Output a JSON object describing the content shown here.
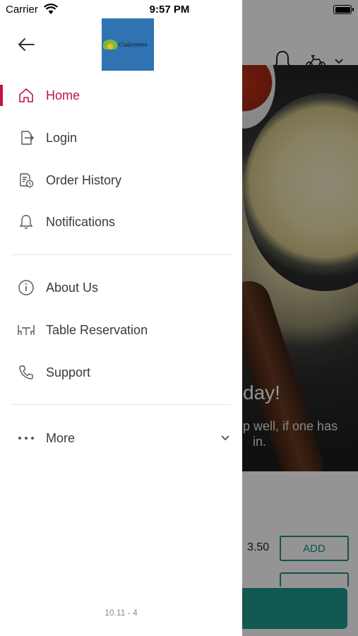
{
  "status_bar": {
    "carrier": "Carrier",
    "time": "9:57 PM"
  },
  "drawer": {
    "menu_primary": [
      {
        "label": "Home",
        "icon": "home-icon",
        "active": true
      },
      {
        "label": "Login",
        "icon": "login-icon",
        "active": false
      },
      {
        "label": "Order History",
        "icon": "order-history-icon",
        "active": false
      },
      {
        "label": "Notifications",
        "icon": "bell-icon",
        "active": false
      }
    ],
    "menu_secondary": [
      {
        "label": "About Us",
        "icon": "info-icon"
      },
      {
        "label": "Table Reservation",
        "icon": "table-icon"
      },
      {
        "label": "Support",
        "icon": "phone-icon"
      }
    ],
    "more_label": "More",
    "version": "10.11 - 4",
    "accent_color": "#c0143c"
  },
  "background_app": {
    "hero_title_partial": "day!",
    "hero_sub_partial_line1": "p well, if one has",
    "hero_sub_partial_line2": "in.",
    "item_price": "3.50",
    "add_button": "ADD",
    "accent_color": "#1c8f86"
  }
}
